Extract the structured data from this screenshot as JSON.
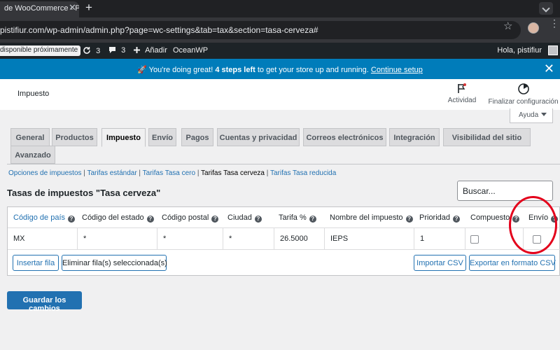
{
  "browser": {
    "tab_title": "de WooCommerce ‹ P",
    "tab_close": "✕",
    "new_tab": "+",
    "url": "pistifiur.com/wp-admin/admin.php?page=wc-settings&tab=tax&section=tasa-cerveza#",
    "star": "☆",
    "kebab": "⋮"
  },
  "adminbar": {
    "notice": " disponible próximamente",
    "updates_count": "3",
    "comments_count": "3",
    "add_new": "Añadir",
    "theme": "OceanWP",
    "greeting": "Hola, pistifiur"
  },
  "banner": {
    "emoji": "🚀",
    "text_start": " You're doing great! ",
    "steps": "4 steps left",
    "text_end": " to get your store up and running. ",
    "link": "Continue setup",
    "close": "✕"
  },
  "header": {
    "title": "Impuesto",
    "activity": "Actividad",
    "finish": "Finalizar configuración",
    "help": "Ayuda"
  },
  "tabs": [
    "General",
    "Productos",
    "Impuesto",
    "Envío",
    "Pagos",
    "Cuentas y privacidad",
    "Correos electrónicos",
    "Integración",
    "Visibilidad del sitio",
    "Avanzado"
  ],
  "active_tab": "Impuesto",
  "subnav": {
    "options": "Opciones de impuestos",
    "standard": "Tarifas estándar",
    "zero": "Tarifas Tasa cero",
    "beer": "Tarifas Tasa cerveza",
    "reduced": "Tarifas Tasa reducida",
    "sep": " | "
  },
  "section_title": "Tasas de impuestos \"Tasa cerveza\"",
  "search_placeholder": "Buscar...",
  "table": {
    "headers": [
      "Código de país",
      "Código del estado",
      "Código postal",
      "Ciudad",
      "Tarifa %",
      "Nombre del impuesto",
      "Prioridad",
      "Compuesto",
      "Envío"
    ],
    "help_glyph": "?",
    "row": {
      "country": "MX",
      "state": "*",
      "postcode": "*",
      "city": "*",
      "rate": "26.5000",
      "name": "IEPS",
      "priority": "1"
    }
  },
  "buttons": {
    "insert": "Insertar fila",
    "delete": "Eliminar fila(s) seleccionada(s)",
    "import": "Importar CSV",
    "export": "Exportar en formato CSV",
    "save": "Guardar los cambios"
  },
  "colors": {
    "banner": "#007cba",
    "primary": "#2271b1",
    "annotation": "#e3001b",
    "adminbar": "#1d2327"
  }
}
